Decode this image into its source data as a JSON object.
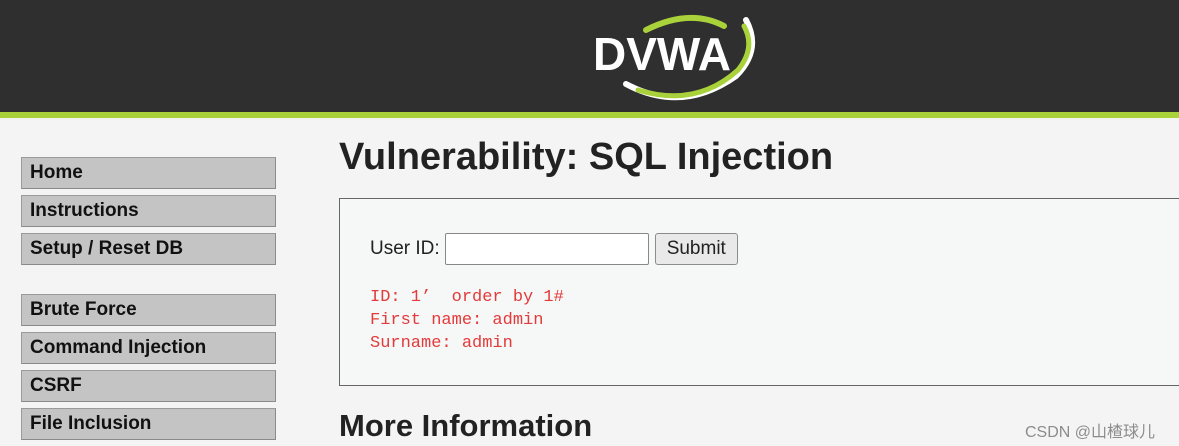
{
  "header": {
    "logo_text": "DVWA",
    "colors": {
      "background": "#2f2f2f",
      "accent": "#a9d23a"
    }
  },
  "menu": {
    "groups": [
      {
        "items": [
          {
            "label": "Home"
          },
          {
            "label": "Instructions"
          },
          {
            "label": "Setup / Reset DB"
          }
        ]
      },
      {
        "items": [
          {
            "label": "Brute Force"
          },
          {
            "label": "Command Injection"
          },
          {
            "label": "CSRF"
          },
          {
            "label": "File Inclusion"
          }
        ]
      }
    ]
  },
  "main": {
    "title": "Vulnerability: SQL Injection",
    "form": {
      "label": "User ID:",
      "input_value": "",
      "submit_label": "Submit"
    },
    "result": {
      "lines": [
        "ID: 1’  order by 1#",
        "First name: admin",
        "Surname: admin"
      ],
      "color": "#e43a3a"
    },
    "more_info_title": "More Information"
  },
  "watermark": "CSDN @山楂球儿"
}
